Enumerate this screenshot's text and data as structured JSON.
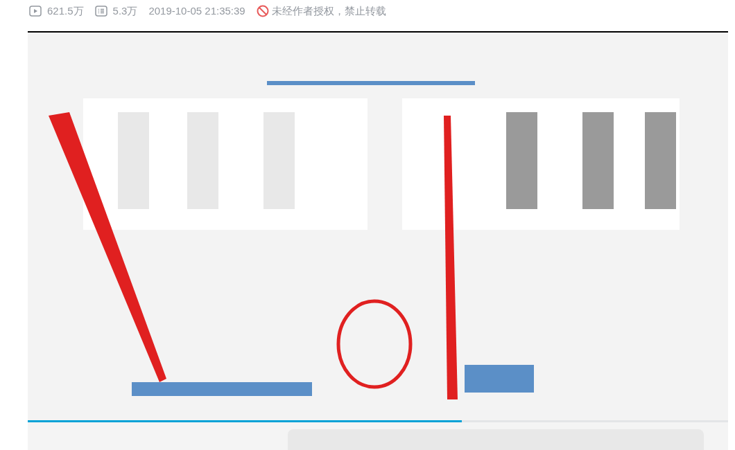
{
  "video_info": {
    "views": "621.5万",
    "danmaku": "5.3万",
    "date": "2019-10-05 21:35:39",
    "notice": "未经作者授权，禁止转载"
  },
  "player": {
    "progress": {
      "level": 0.62
    }
  }
}
